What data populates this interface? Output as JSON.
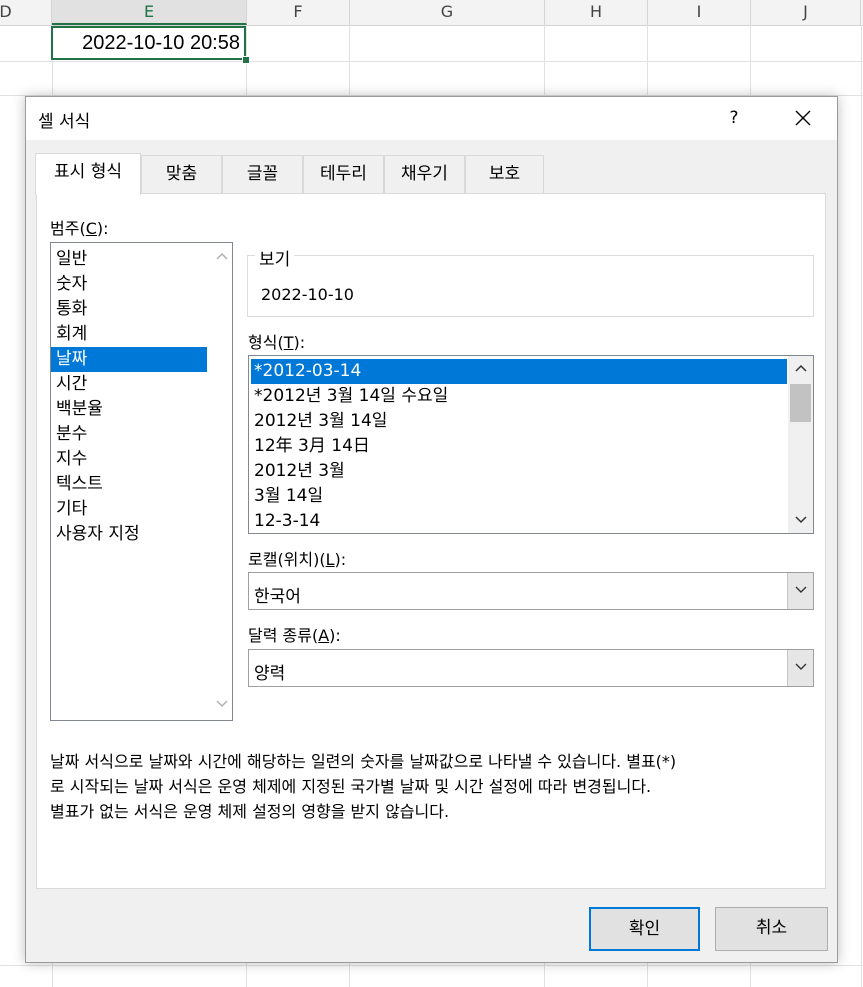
{
  "sheet": {
    "columns": [
      "D",
      "E",
      "F",
      "G",
      "H",
      "I",
      "J"
    ],
    "partial_column": "D",
    "column_display": [
      "D",
      "E",
      "F",
      "G",
      "H",
      "I",
      "J"
    ],
    "active_column": "E",
    "active_cell_value": "2022-10-10 20:58"
  },
  "dialog": {
    "title": "셀 서식",
    "help_label": "?",
    "close_label": "✕",
    "tabs": [
      {
        "label": "표시 형식",
        "selected": true
      },
      {
        "label": "맞춤",
        "selected": false
      },
      {
        "label": "글꼴",
        "selected": false
      },
      {
        "label": "테두리",
        "selected": false
      },
      {
        "label": "채우기",
        "selected": false
      },
      {
        "label": "보호",
        "selected": false
      }
    ],
    "category": {
      "label_prefix": "범주(",
      "label_key": "C",
      "label_suffix": "):",
      "items": [
        "일반",
        "숫자",
        "통화",
        "회계",
        "날짜",
        "시간",
        "백분율",
        "분수",
        "지수",
        "텍스트",
        "기타",
        "사용자 지정"
      ],
      "selected": "날짜"
    },
    "sample": {
      "legend": "보기",
      "value": "2022-10-10"
    },
    "type": {
      "label_prefix": "형식(",
      "label_key": "T",
      "label_suffix": "):",
      "items": [
        "*2012-03-14",
        "*2012년 3월 14일 수요일",
        "2012년 3월 14일",
        "12年 3月 14日",
        "2012년 3월",
        "3월 14일",
        "12-3-14"
      ],
      "selected": "*2012-03-14"
    },
    "locale": {
      "label_prefix": "로캘(위치)(",
      "label_key": "L",
      "label_suffix": "):",
      "value": "한국어"
    },
    "calendar": {
      "label_prefix": "달력 종류(",
      "label_key": "A",
      "label_suffix": "):",
      "value": "양력"
    },
    "description": [
      "날짜 서식으로 날짜와 시간에 해당하는 일련의 숫자를 날짜값으로 나타낼 수 있습니다. 별표(*)",
      "로 시작되는 날짜 서식은 운영 체제에 지정된 국가별 날짜 및 시간 설정에 따라 변경됩니다.",
      "별표가 없는 서식은 운영 체제 설정의 영향을 받지 않습니다."
    ],
    "ok_label": "확인",
    "cancel_label": "취소"
  },
  "colors": {
    "selection": "#0078d7",
    "excel_green": "#217346"
  }
}
